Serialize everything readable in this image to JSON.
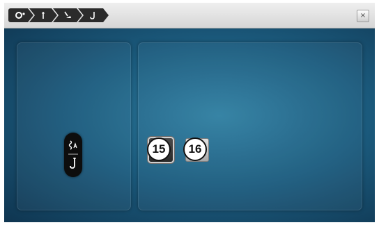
{
  "topbar": {
    "breadcrumbs": [
      {
        "icon": "stitch-settings-icon"
      },
      {
        "icon": "needle-icon"
      },
      {
        "icon": "presser-foot-icon"
      },
      {
        "icon": "thread-hook-icon"
      }
    ],
    "close_label": "×"
  },
  "status_indicator": {
    "icons": [
      "thread-tension-icon",
      "thread-hook-icon"
    ]
  },
  "options": [
    {
      "number": "15",
      "icon": "thread-hook-icon",
      "selected": true
    },
    {
      "number": "16",
      "icon": "thread-tension-icon",
      "selected": false
    }
  ],
  "colors": {
    "background": "#1c5d80",
    "active_button": "#333333",
    "inactive_button": "#c8c8c8"
  }
}
